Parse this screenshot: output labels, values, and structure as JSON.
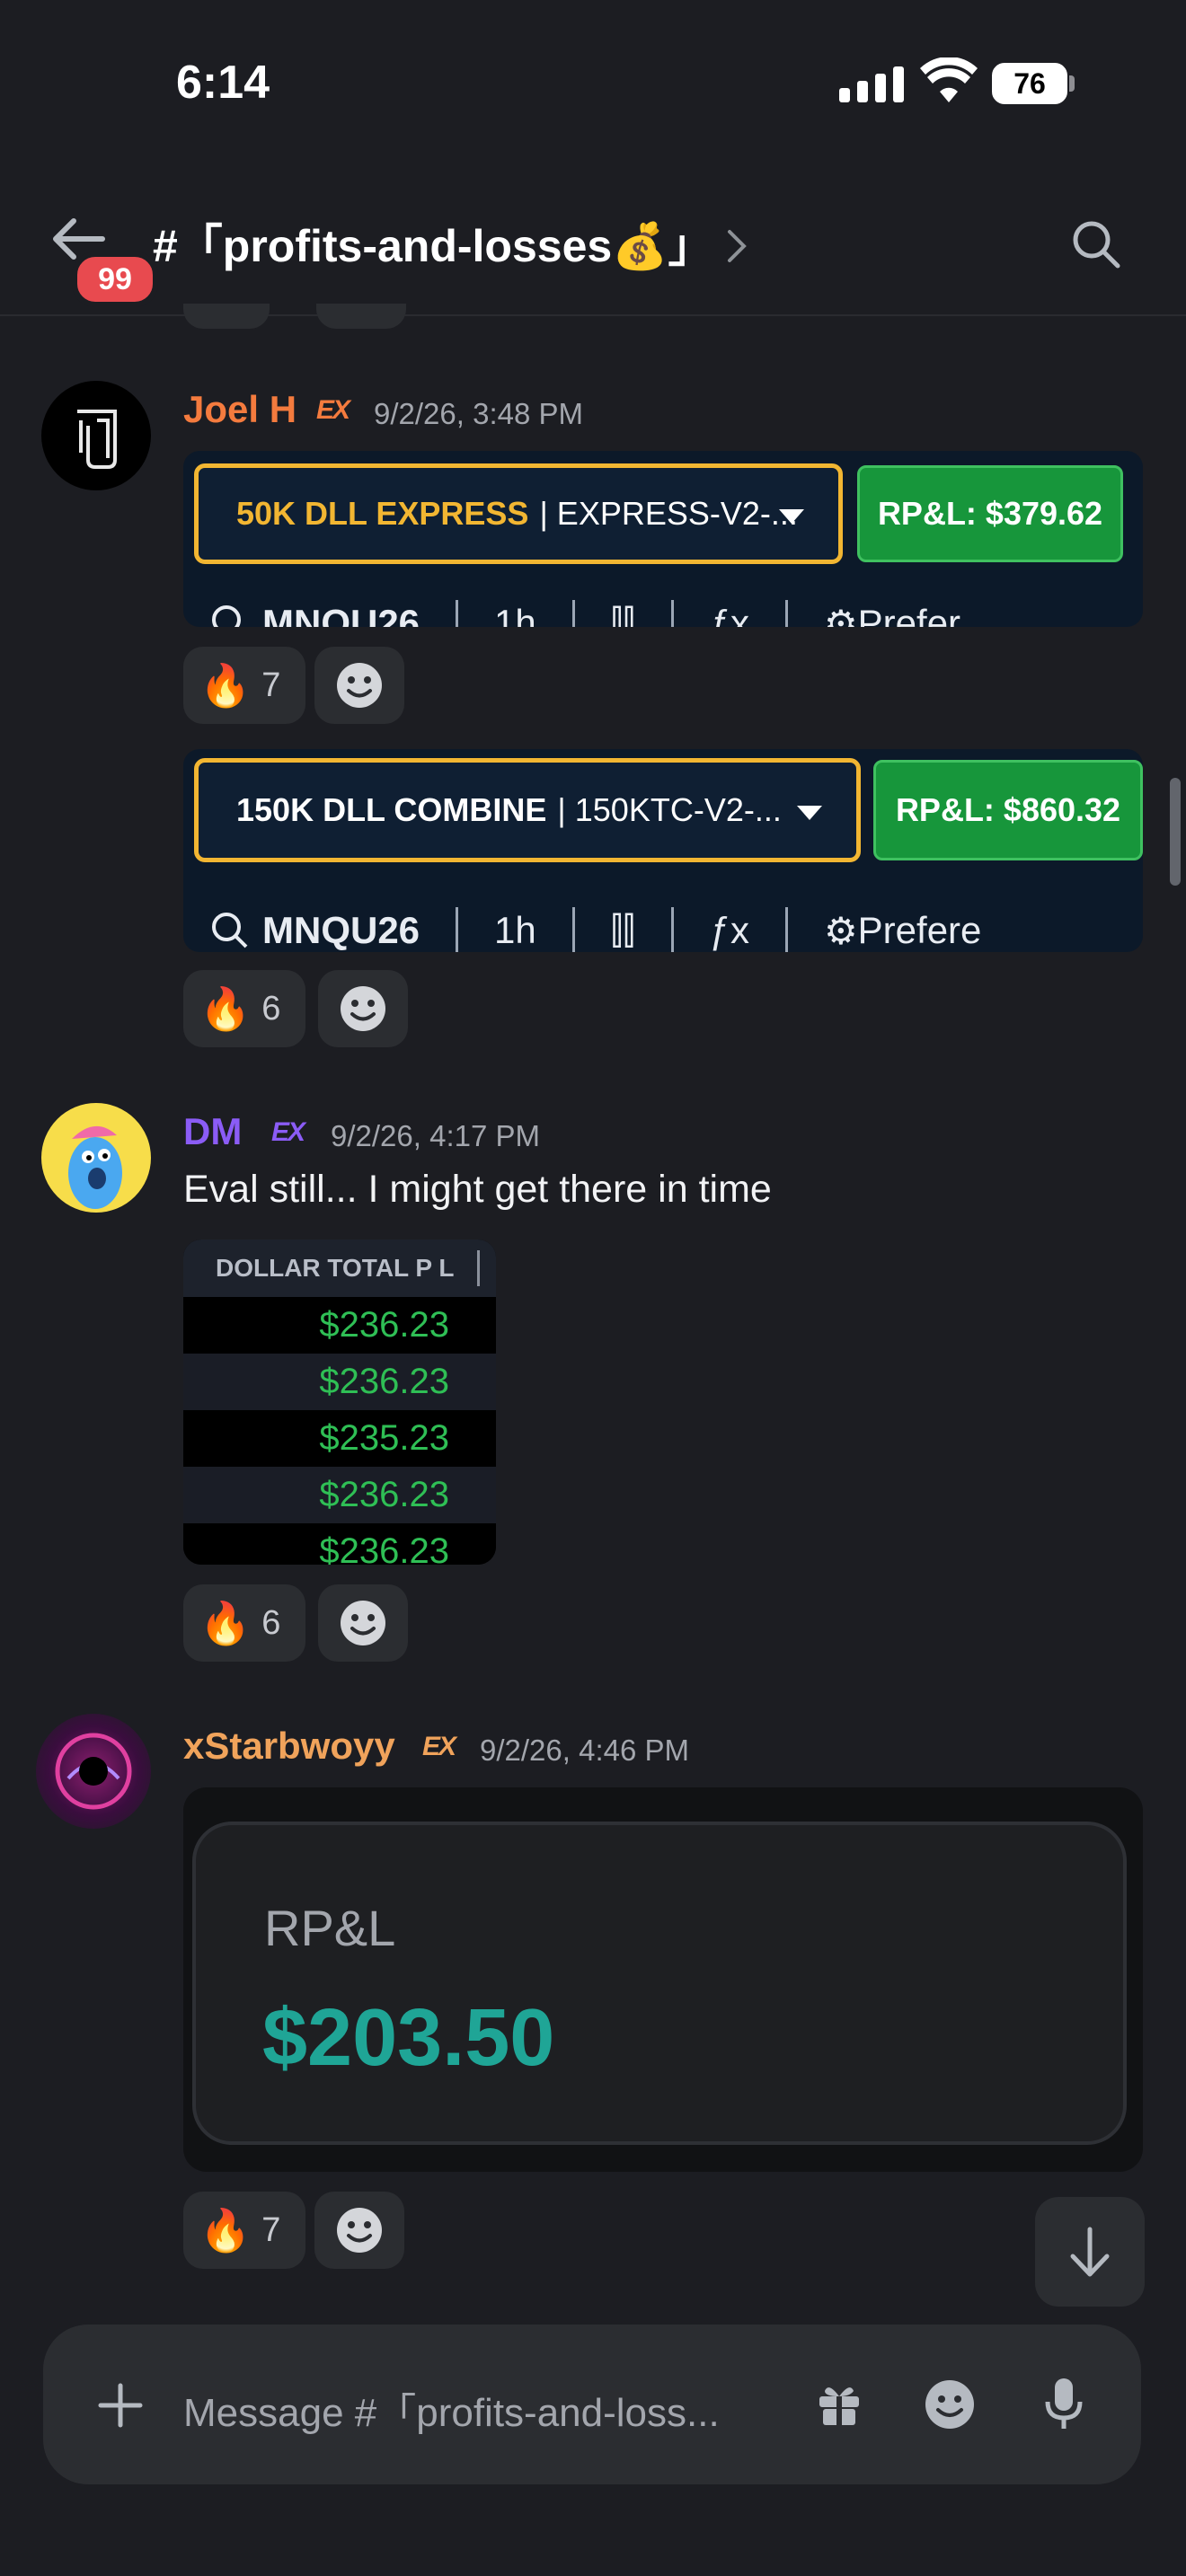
{
  "status": {
    "time": "6:14",
    "battery": "76"
  },
  "header": {
    "badge": "99",
    "channel": "#「profits-and-losses💰」"
  },
  "messages": [
    {
      "username": "Joel H",
      "username_color": "#f47b3e",
      "tag": "EX",
      "timestamp": "9/2/26, 3:48 PM",
      "attachments": [
        {
          "account_name": "50K DLL EXPRESS",
          "account_id": "| EXPRESS-V2-...",
          "account_name_color": "#f2b632",
          "rpl": "RP&L: $379.62",
          "toolbar": [
            "MNQU26",
            "1h",
            "ƒx",
            "Prefer"
          ],
          "reaction_count": "7"
        },
        {
          "account_name": "150K DLL COMBINE",
          "account_id": "| 150KTC-V2-...",
          "account_name_color": "#ffffff",
          "rpl": "RP&L: $860.32",
          "toolbar": [
            "MNQU26",
            "1h",
            "ƒx",
            "Prefere"
          ],
          "reaction_count": "6"
        }
      ]
    },
    {
      "username": "DM",
      "username_color": "#8b5cf6",
      "tag": "EX",
      "timestamp": "9/2/26, 4:17 PM",
      "text": "Eval still... I might get there in time",
      "table": {
        "header": "DOLLAR TOTAL P L",
        "rows": [
          "$236.23",
          "$236.23",
          "$235.23",
          "$236.23",
          "$236.23"
        ]
      },
      "reaction_count": "6"
    },
    {
      "username": "xStarbwoyy",
      "username_color": "#f0a35b",
      "tag": "EX",
      "timestamp": "9/2/26, 4:46 PM",
      "card": {
        "label": "RP&L",
        "value": "$203.50",
        "value_color": "#1fa596"
      },
      "reaction_count": "7"
    }
  ],
  "composer": {
    "placeholder": "Message #「profits-and-loss..."
  },
  "icons": [
    "back-arrow-icon",
    "search-icon",
    "fire-icon",
    "add-reaction-icon",
    "plus-icon",
    "gift-icon",
    "emoji-icon",
    "mic-icon",
    "arrow-down-icon"
  ]
}
